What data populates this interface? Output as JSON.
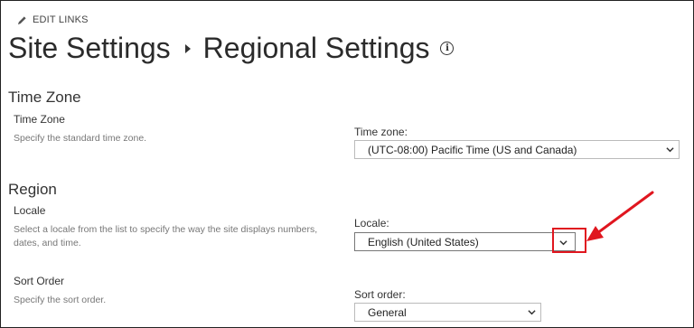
{
  "toolbar": {
    "edit_links": "EDIT LINKS",
    "pencil_icon": "pencil-icon"
  },
  "header": {
    "breadcrumb_parent": "Site Settings",
    "title": "Regional Settings",
    "info_icon": "i"
  },
  "time_zone_section": {
    "heading": "Time Zone",
    "label": "Time Zone",
    "description": "Specify the standard time zone.",
    "control_label": "Time zone:",
    "selected": "(UTC-08:00) Pacific Time (US and Canada)"
  },
  "region_section": {
    "heading": "Region",
    "locale": {
      "label": "Locale",
      "description_line1": "Select a locale from the list to specify the way the site displays numbers,",
      "description_line2": "dates, and time.",
      "control_label": "Locale:",
      "selected": "English (United States)"
    },
    "sort_order": {
      "label": "Sort Order",
      "description": "Specify the sort order.",
      "control_label": "Sort order:",
      "selected": "General"
    }
  },
  "colors": {
    "highlight": "#e0161f",
    "arrow": "#e0161f"
  }
}
